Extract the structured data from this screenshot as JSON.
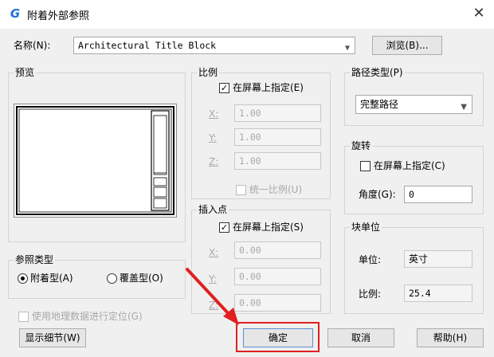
{
  "window": {
    "title": "附着外部参照",
    "close_glyph": "✕"
  },
  "name_row": {
    "label": "名称(N):",
    "value": "Architectural Title Block",
    "browse_label": "浏览(B)..."
  },
  "preview": {
    "label": "预览"
  },
  "scale": {
    "label": "比例",
    "specify_label": "在屏幕上指定(E)",
    "specify_checked": true,
    "x_label": "X:",
    "x_value": "1.00",
    "y_label": "Y:",
    "y_value": "1.00",
    "z_label": "Z:",
    "z_value": "1.00",
    "uniform_label": "统一比例(U)",
    "uniform_checked": false
  },
  "insertion": {
    "label": "插入点",
    "specify_label": "在屏幕上指定(S)",
    "specify_checked": true,
    "x_label": "X:",
    "x_value": "0.00",
    "y_label": "Y:",
    "y_value": "0.00",
    "z_label": "Z:",
    "z_value": "0.00"
  },
  "path_type": {
    "label": "路径类型(P)",
    "selected": "完整路径"
  },
  "rotation": {
    "label": "旋转",
    "specify_label": "在屏幕上指定(C)",
    "specify_checked": false,
    "angle_label": "角度(G):",
    "angle_value": "0"
  },
  "block_unit": {
    "label": "块单位",
    "unit_label": "单位:",
    "unit_value": "英寸",
    "ratio_label": "比例:",
    "ratio_value": "25.4"
  },
  "reference_type": {
    "label": "参照类型",
    "attach_label": "附着型(A)",
    "overlay_label": "覆盖型(O)",
    "selected": "attach"
  },
  "geo": {
    "label": "使用地理数据进行定位(G)",
    "checked": false
  },
  "buttons": {
    "details": "显示细节(W)",
    "ok": "确定",
    "cancel": "取消",
    "help": "帮助(H)"
  },
  "colors": {
    "accent_icon": "#1a6fd6",
    "annotation_red": "#e02020"
  }
}
